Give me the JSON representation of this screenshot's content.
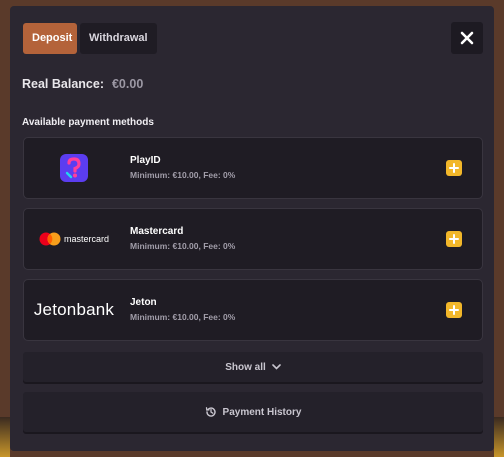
{
  "tabs": [
    {
      "label": "Deposit",
      "active": true
    },
    {
      "label": "Withdrawal",
      "active": false
    }
  ],
  "close_icon": "close-icon",
  "balance": {
    "label": "Real Balance:",
    "value": "€0.00"
  },
  "section_title": "Available payment methods",
  "methods": [
    {
      "name": "PlayID",
      "meta": "Minimum: €10.00, Fee: 0%",
      "logo": "playid-logo"
    },
    {
      "name": "Mastercard",
      "meta": "Minimum: €10.00, Fee: 0%",
      "logo": "mastercard-logo",
      "logo_text": "mastercard"
    },
    {
      "name": "Jeton",
      "meta": "Minimum: €10.00, Fee: 0%",
      "logo": "jeton-logo",
      "logo_text": "Jetonbank"
    }
  ],
  "show_all_label": "Show all",
  "history_label": "Payment History",
  "colors": {
    "accent": "#b4633a",
    "add_button": "#f2b72a",
    "modal_bg": "#2b2731",
    "card_bg": "#1f1c24"
  }
}
